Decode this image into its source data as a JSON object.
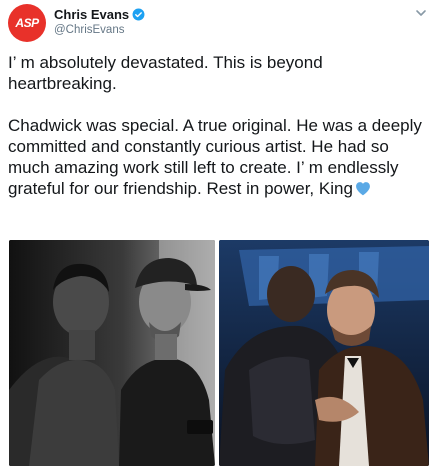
{
  "author": {
    "avatar_text": "ASP",
    "display_name": "Chris Evans",
    "handle": "@ChrisEvans",
    "verified": true,
    "avatar_color": "#e8312a",
    "verified_color": "#1da1f2"
  },
  "tweet": {
    "paragraph_1": "I’ m absolutely devastated. This is beyond heartbreaking.",
    "paragraph_2": "Chadwick was special. A true original. He was a deeply committed and constantly curious artist. He had so much amazing work still left to create. I’ m endlessly grateful for our friendship. Rest in power, King",
    "emoji": "blue-heart",
    "emoji_color": "#5aa9e6"
  },
  "media": {
    "photos": [
      {
        "description_icon": "bw-photo-two-men"
      },
      {
        "description_icon": "color-photo-two-men-embracing"
      }
    ]
  },
  "icons": {
    "menu": "chevron-down-icon",
    "verified": "verified-badge-icon"
  }
}
